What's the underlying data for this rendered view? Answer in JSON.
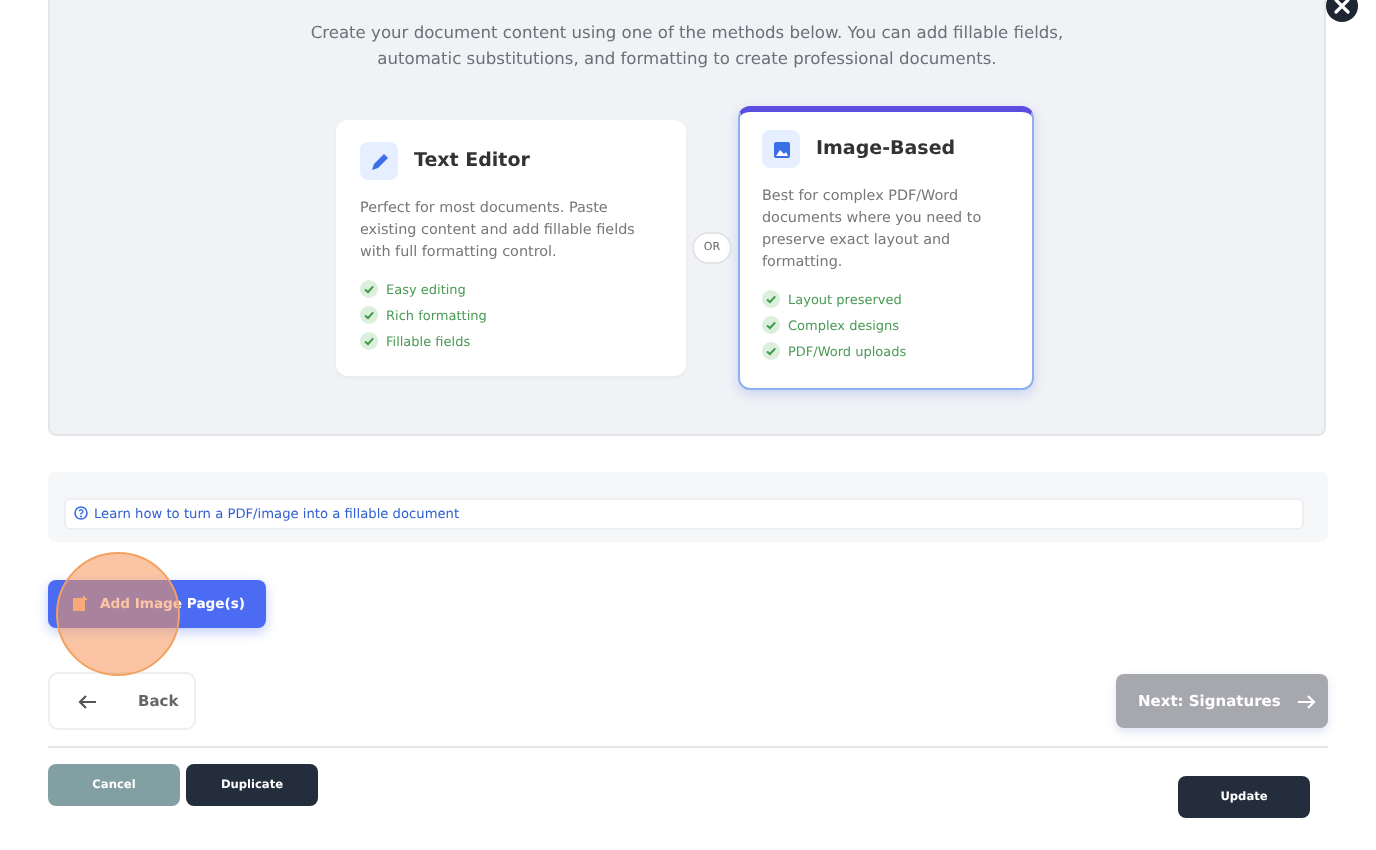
{
  "intro": "Create your document content using one of the methods below. You can add fillable fields, automatic substitutions, and formatting to create professional documents.",
  "methods": [
    {
      "kind": "text",
      "title": "Text Editor",
      "description": "Perfect for most documents. Paste existing content and add fillable fields with full formatting control.",
      "features": [
        "Easy editing",
        "Rich formatting",
        "Fillable fields"
      ],
      "selected": false
    },
    {
      "kind": "image",
      "title": "Image-Based",
      "description": "Best for complex PDF/Word documents where you need to preserve exact layout and formatting.",
      "features": [
        "Layout preserved",
        "Complex designs",
        "PDF/Word uploads"
      ],
      "selected": true
    }
  ],
  "separator": "OR",
  "help_link": "Learn how to turn a PDF/image into a fillable document",
  "add_button": "Add Image Page(s)",
  "back_button": "Back",
  "next_button": {
    "label": "Next: Signatures",
    "disabled": true
  },
  "footer_buttons": [
    {
      "label": "Cancel",
      "kind": "muted"
    },
    {
      "label": "Duplicate",
      "kind": "dark"
    }
  ],
  "update_button": "Update"
}
